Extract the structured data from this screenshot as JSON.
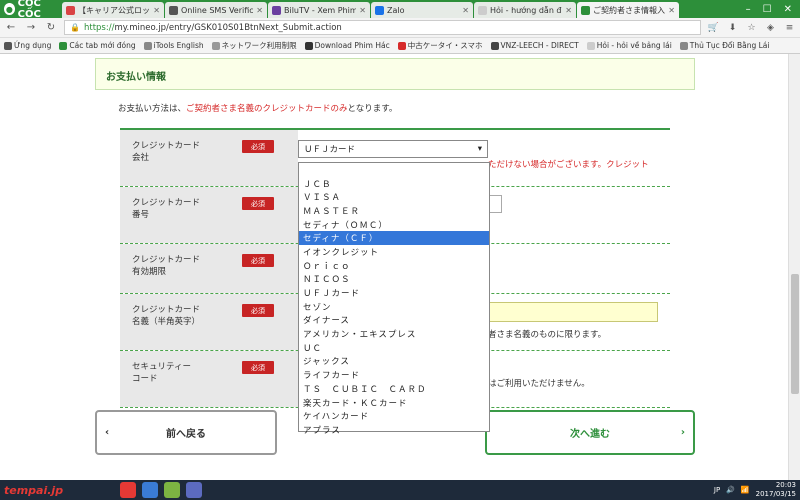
{
  "browser": {
    "name": "CỐC CỐC",
    "tabs": [
      {
        "title": "【キャリア公式ロック",
        "color": "#d94444"
      },
      {
        "title": "Online SMS Verificat",
        "color": "#555555"
      },
      {
        "title": "BiluTV - Xem Phim M",
        "color": "#6b3fa0"
      },
      {
        "title": "Zalo",
        "color": "#1a73e8"
      },
      {
        "title": "Hỏi - hướng dẫn đăng",
        "color": "#cccccc"
      },
      {
        "title": "ご契約者さま情報入力",
        "color": "#2d8f3a",
        "active": true
      }
    ],
    "url_scheme": "https://",
    "url_rest": "my.mineo.jp/entry/GSK010S01BtnNext_Submit.action",
    "bookmarks": [
      {
        "label": "Ứng dụng",
        "color": "#555555"
      },
      {
        "label": "Các tab mới đóng",
        "color": "#2d8f3a"
      },
      {
        "label": "iTools English",
        "color": "#888888"
      },
      {
        "label": "ネットワーク利用制限",
        "color": "#999999"
      },
      {
        "label": "Download Phim Hác",
        "color": "#333333"
      },
      {
        "label": "中古ケータイ・スマホ",
        "color": "#d62a2a"
      },
      {
        "label": "VNZ-LEECH - DIRECT",
        "color": "#444444"
      },
      {
        "label": "Hỏi - hỏi về bảng lái",
        "color": "#cccccc"
      },
      {
        "label": "Thủ Tục Đổi Bằng Lái",
        "color": "#888888"
      }
    ]
  },
  "page": {
    "section_title": "お支払い情報",
    "notice_prefix": "お支払い方法は、",
    "notice_red": "ご契約者さま名義のクレジットカードのみ",
    "notice_suffix": "となります。",
    "required_label": "必須",
    "rows": {
      "card_company": {
        "line1": "クレジットカード",
        "line2": "会社"
      },
      "card_number": {
        "line1": "クレジットカード",
        "line2": "番号"
      },
      "expiry": {
        "line1": "クレジットカード",
        "line2": "有効期限"
      },
      "name": {
        "line1": "クレジットカード",
        "line2": "名義（半角英字）"
      },
      "security": {
        "line1": "セキュリティー",
        "line2": "コード"
      }
    },
    "select_value": "ＵＦＪカード",
    "warn_text": "ただけない場合がございます。クレジット",
    "name_note": "者さま名義のものに限ります。",
    "sec_note": "はご利用いただけません。",
    "dropdown_options": [
      "",
      "ＪＣＢ",
      "ＶＩＳＡ",
      "ＭＡＳＴＥＲ",
      "セディナ（ＯＭＣ）",
      "セディナ（ＣＦ）",
      "イオンクレジット",
      "Ｏｒｉｃｏ",
      "ＮＩＣＯＳ",
      "ＵＦＪカード",
      "セゾン",
      "ダイナース",
      "アメリカン・エキスプレス",
      "ＵＣ",
      "ジャックス",
      "ライフカード",
      "ＴＳ　ＣＵＢＩＣ　ＣＡＲＤ",
      "楽天カード・ＫＣカード",
      "ケイハンカード",
      "アプラス"
    ],
    "selected_index": 5,
    "back_label": "前へ戻る",
    "next_label": "次へ進む"
  },
  "taskbar": {
    "logo": "tempai.jp",
    "lang": "JP",
    "time": "20:03",
    "date": "2017/03/15"
  }
}
